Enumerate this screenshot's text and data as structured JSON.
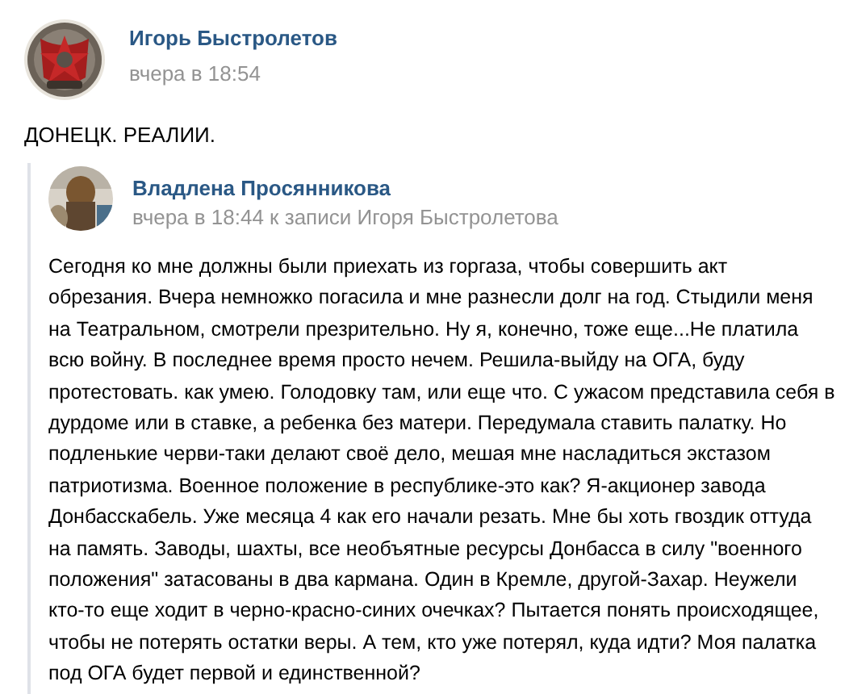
{
  "post": {
    "author": "Игорь Быстролетов",
    "time": "вчера в 18:54",
    "text": "ДОНЕЦК. РЕАЛИИ."
  },
  "repost": {
    "author": "Владлена Просянникова",
    "time": "вчера в 18:44 к записи Игоря Быстролетова",
    "text": "Сегодня ко мне должны были приехать из горгаза, чтобы совершить акт обрезания. Вчера немножко погасила и мне разнесли долг на год. Стыдили меня на Театральном, смотрели презрительно. Ну я, конечно, тоже еще...Не платила всю войну. В последнее время просто нечем. Решила-выйду на ОГА, буду протестовать. как умею. Голодовку там, или еще что. С ужасом представила себя в дурдоме или в ставке, а ребенка без матери. Передумала ставить палатку. Но подленькие черви-таки делают своё дело, мешая мне насладиться экстазом патриотизма. Военное положение в республике-это как? Я-акционер завода Донбасскабель. Уже месяца 4 как его начали резать. Мне бы хоть гвоздик оттуда на память. Заводы, шахты, все необъятные ресурсы Донбасса в силу \"военного положения\" затасованы в два кармана. Один в Кремле, другой-Захар. Неужели кто-то еще ходит в черно-красно-синих очечках? Пытается понять происходящее, чтобы не потерять остатки веры. А тем, кто уже потерял, куда идти? Моя палатка под ОГА будет первой и единственной?"
  }
}
